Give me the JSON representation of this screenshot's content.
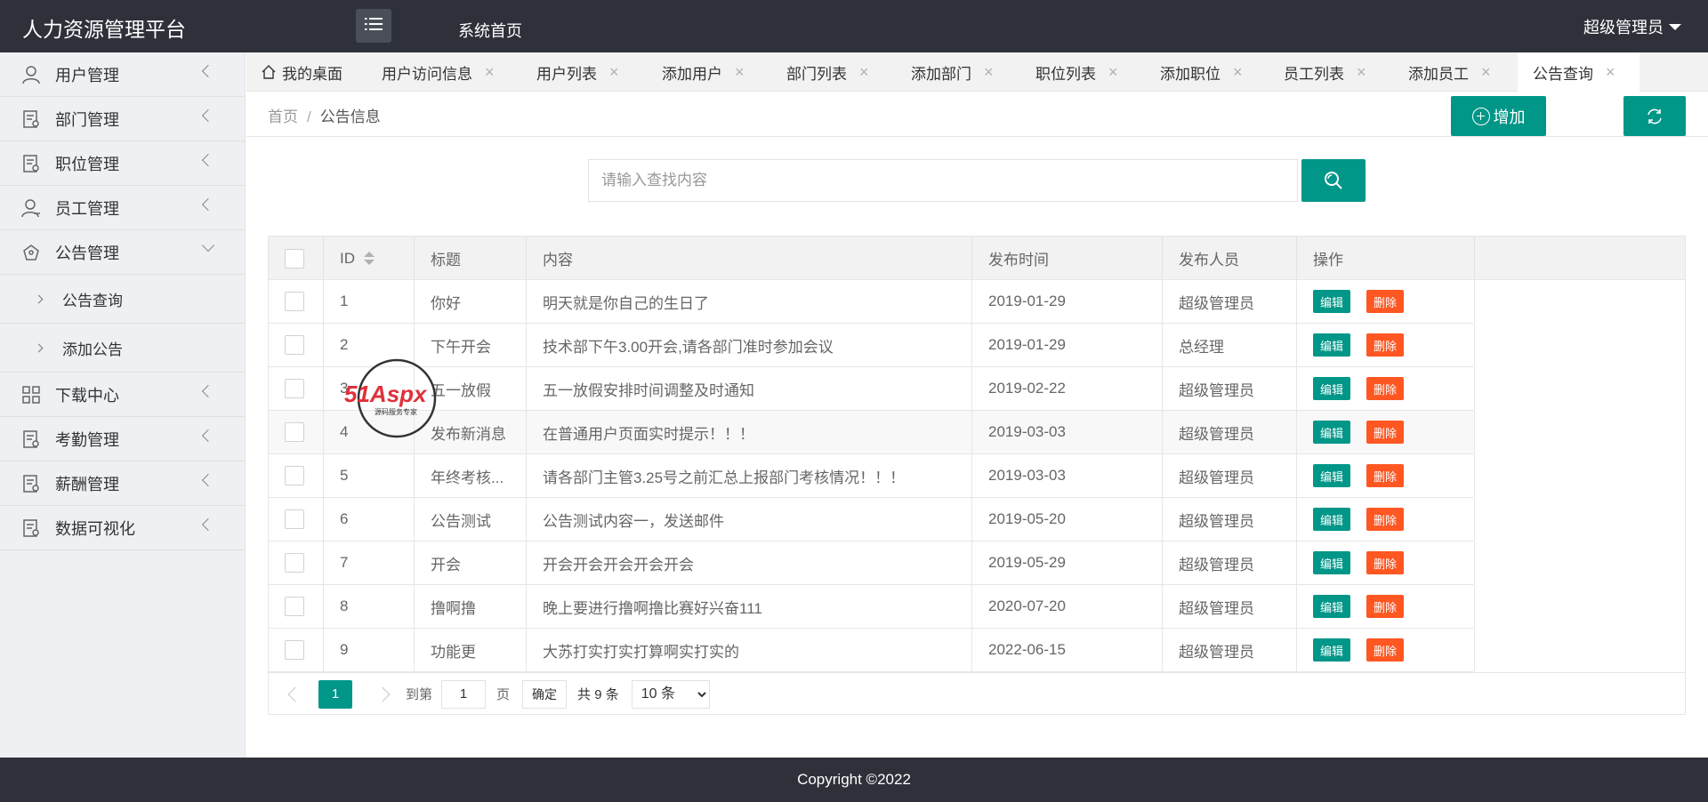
{
  "header": {
    "title": "人力资源管理平台",
    "home_link": "系统首页",
    "user": "超级管理员"
  },
  "sidebar": {
    "items": [
      {
        "label": "用户管理",
        "icon": "user-icon"
      },
      {
        "label": "部门管理",
        "icon": "document-icon"
      },
      {
        "label": "职位管理",
        "icon": "document-icon"
      },
      {
        "label": "员工管理",
        "icon": "person-icon"
      },
      {
        "label": "公告管理",
        "icon": "notice-icon",
        "expanded": true
      },
      {
        "label": "下载中心",
        "icon": "grid-icon"
      },
      {
        "label": "考勤管理",
        "icon": "document-icon"
      },
      {
        "label": "薪酬管理",
        "icon": "document-icon"
      },
      {
        "label": "数据可视化",
        "icon": "document-icon"
      }
    ],
    "sub_items": [
      "公告查询",
      "添加公告"
    ]
  },
  "tabs": [
    {
      "label": "我的桌面",
      "closable": false
    },
    {
      "label": "用户访问信息",
      "closable": true
    },
    {
      "label": "用户列表",
      "closable": true
    },
    {
      "label": "添加用户",
      "closable": true
    },
    {
      "label": "部门列表",
      "closable": true
    },
    {
      "label": "添加部门",
      "closable": true
    },
    {
      "label": "职位列表",
      "closable": true
    },
    {
      "label": "添加职位",
      "closable": true
    },
    {
      "label": "员工列表",
      "closable": true
    },
    {
      "label": "添加员工",
      "closable": true
    },
    {
      "label": "公告查询",
      "closable": true,
      "active": true
    }
  ],
  "tab_close_glyph": "×",
  "breadcrumb": {
    "home": "首页",
    "sep": "/",
    "current": "公告信息"
  },
  "actions": {
    "add_label": "增加"
  },
  "search": {
    "placeholder": "请输入查找内容",
    "value": ""
  },
  "table": {
    "columns": [
      "ID",
      "标题",
      "内容",
      "发布时间",
      "发布人员",
      "操作"
    ],
    "edit_label": "编辑",
    "delete_label": "删除",
    "rows": [
      {
        "id": "1",
        "title": "你好",
        "content": "明天就是你自己的生日了",
        "date": "2019-01-29",
        "author": "超级管理员"
      },
      {
        "id": "2",
        "title": "下午开会",
        "content": "技术部下午3.00开会,请各部门准时参加会议",
        "date": "2019-01-29",
        "author": "总经理"
      },
      {
        "id": "3",
        "title": "五一放假",
        "content": "五一放假安排时间调整及时通知",
        "date": "2019-02-22",
        "author": "超级管理员"
      },
      {
        "id": "4",
        "title": "发布新消息",
        "content": "在普通用户页面实时提示！！！",
        "date": "2019-03-03",
        "author": "超级管理员"
      },
      {
        "id": "5",
        "title": "年终考核...",
        "content": "请各部门主管3.25号之前汇总上报部门考核情况！！！",
        "date": "2019-03-03",
        "author": "超级管理员"
      },
      {
        "id": "6",
        "title": "公告测试",
        "content": "公告测试内容一，发送邮件",
        "date": "2019-05-20",
        "author": "超级管理员"
      },
      {
        "id": "7",
        "title": "开会",
        "content": "开会开会开会开会开会",
        "date": "2019-05-29",
        "author": "超级管理员"
      },
      {
        "id": "8",
        "title": "撸啊撸",
        "content": "晚上要进行撸啊撸比赛好兴奋111",
        "date": "2020-07-20",
        "author": "超级管理员"
      },
      {
        "id": "9",
        "title": "功能更",
        "content": "大苏打实打实打算啊实打实的",
        "date": "2022-06-15",
        "author": "超级管理员"
      }
    ]
  },
  "pagination": {
    "current": "1",
    "goto_label": "到第",
    "goto_value": "1",
    "page_label": "页",
    "ok_label": "确定",
    "total": "共 9 条",
    "page_size": "10 条"
  },
  "watermark": {
    "brand": "51Aspx",
    "tagline": "源码服务专家"
  },
  "footer": {
    "copyright": "Copyright ©2022"
  },
  "colors": {
    "accent": "#009688",
    "danger": "#ff5722",
    "header_bg": "#2e313a"
  }
}
